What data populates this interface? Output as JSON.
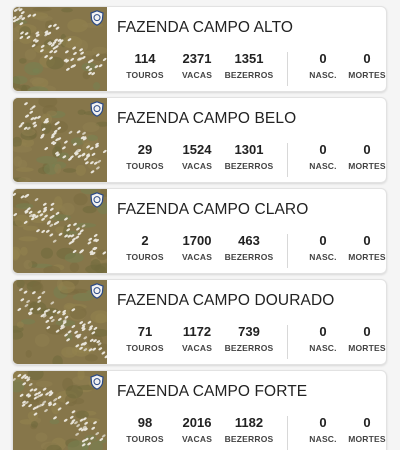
{
  "labels": {
    "touros": "TOUROS",
    "vacas": "VACAS",
    "bezerros": "BEZERROS",
    "nasc": "NASC.",
    "mortes": "MORTES"
  },
  "farms": [
    {
      "name": "FAZENDA CAMPO ALTO",
      "touros": "114",
      "vacas": "2371",
      "bezerros": "1351",
      "nasc": "0",
      "mortes": "0"
    },
    {
      "name": "FAZENDA CAMPO BELO",
      "touros": "29",
      "vacas": "1524",
      "bezerros": "1301",
      "nasc": "0",
      "mortes": "0"
    },
    {
      "name": "FAZENDA CAMPO CLARO",
      "touros": "2",
      "vacas": "1700",
      "bezerros": "463",
      "nasc": "0",
      "mortes": "0"
    },
    {
      "name": "FAZENDA CAMPO DOURADO",
      "touros": "71",
      "vacas": "1172",
      "bezerros": "739",
      "nasc": "0",
      "mortes": "0"
    },
    {
      "name": "FAZENDA CAMPO FORTE",
      "touros": "98",
      "vacas": "2016",
      "bezerros": "1182",
      "nasc": "0",
      "mortes": "0"
    }
  ],
  "thumbnail_icon": "cattle-herd-aerial-photo",
  "badge_icon": "brand-emblem-icon",
  "colors": {
    "card_bg": "#ffffff",
    "page_bg": "#f5f5f5",
    "text": "#222222"
  }
}
